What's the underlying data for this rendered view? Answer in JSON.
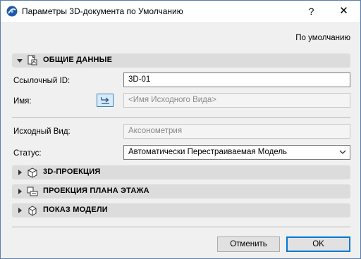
{
  "window": {
    "title": "Параметры 3D-документа по Умолчанию",
    "help_label": "?",
    "close_label": "✕"
  },
  "defaults_label": "По умолчанию",
  "sections": {
    "general": {
      "title": "ОБЩИЕ ДАННЫЕ",
      "expanded": true
    },
    "projection_3d": {
      "title": "3D-ПРОЕКЦИЯ",
      "expanded": false
    },
    "floor_plan_projection": {
      "title": "ПРОЕКЦИЯ ПЛАНА ЭТАЖА",
      "expanded": false
    },
    "model_display": {
      "title": "ПОКАЗ МОДЕЛИ",
      "expanded": false
    }
  },
  "fields": {
    "ref_id": {
      "label": "Ссылочный ID:",
      "value": "3D-01"
    },
    "name": {
      "label": "Имя:",
      "placeholder": "<Имя Исходного Вида>"
    },
    "source_view": {
      "label": "Исходный Вид:",
      "value": "Аксонометрия"
    },
    "status": {
      "label": "Статус:",
      "value": "Автоматически Перестраиваемая Модель"
    }
  },
  "buttons": {
    "cancel": "Отменить",
    "ok": "OK"
  },
  "colors": {
    "section_header_bg": "#dcdcdc",
    "accent": "#0078d7",
    "link_button_bg": "#d8eaf9"
  }
}
